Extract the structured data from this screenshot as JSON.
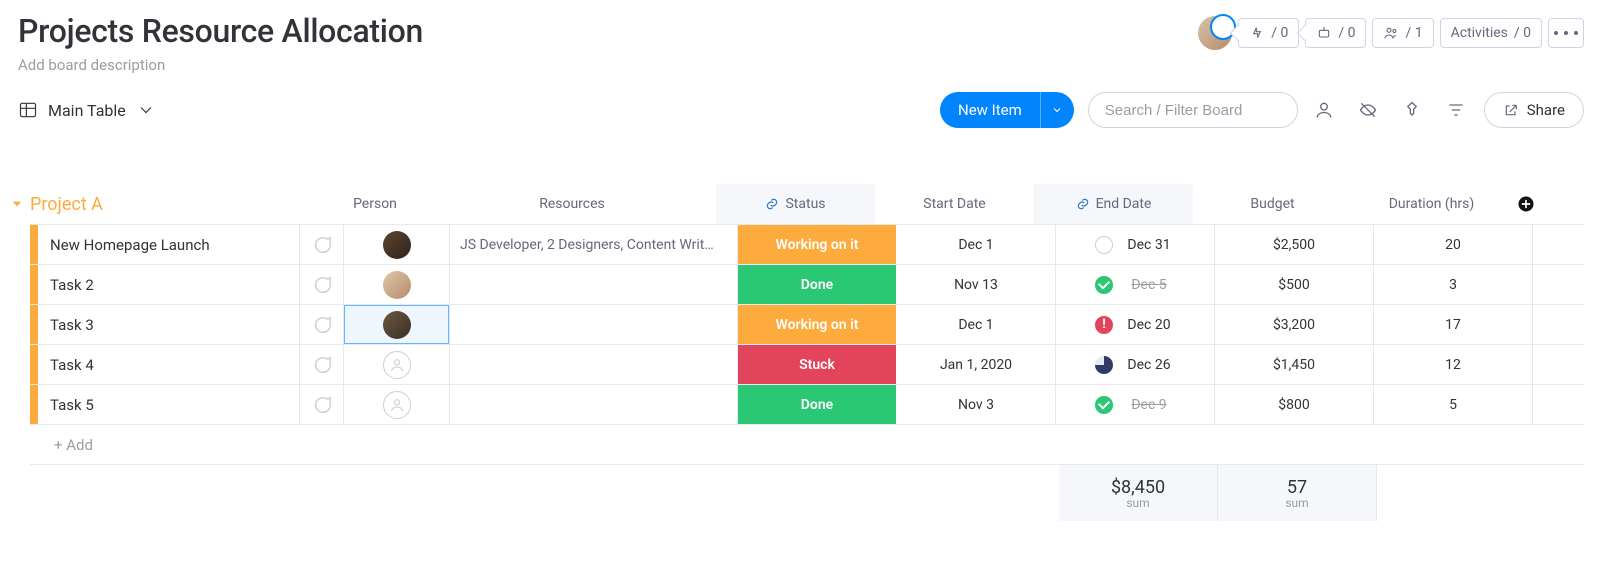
{
  "header": {
    "title": "Projects Resource Allocation",
    "description": "Add board description"
  },
  "pills": {
    "automations": "0",
    "integrations": "0",
    "members": "1",
    "activities_label": "Activities",
    "activities_count": "0"
  },
  "view": {
    "name": "Main Table"
  },
  "toolbar": {
    "new_item": "New Item",
    "search_placeholder": "Search / Filter Board",
    "share": "Share"
  },
  "group": {
    "name": "Project A",
    "columns": {
      "person": "Person",
      "resources": "Resources",
      "status": "Status",
      "start": "Start Date",
      "end": "End Date",
      "budget": "Budget",
      "duration": "Duration (hrs)"
    },
    "rows": [
      {
        "name": "New Homepage Launch",
        "avatar": "pa-1",
        "resources": "JS Developer, 2 Designers, Content Writ…",
        "status": "Working on it",
        "status_cls": "st-working",
        "start": "Dec 1",
        "end": "Dec 31",
        "end_ind": "open",
        "end_strike": false,
        "budget": "$2,500",
        "duration": "20"
      },
      {
        "name": "Task 2",
        "avatar": "pa-2",
        "resources": "",
        "status": "Done",
        "status_cls": "st-done",
        "start": "Nov 13",
        "end": "Dec 5",
        "end_ind": "done",
        "end_strike": true,
        "budget": "$500",
        "duration": "3"
      },
      {
        "name": "Task 3",
        "avatar": "pa-3",
        "resources": "",
        "selected": true,
        "status": "Working on it",
        "status_cls": "st-working",
        "start": "Dec 1",
        "end": "Dec 20",
        "end_ind": "late",
        "end_strike": false,
        "budget": "$3,200",
        "duration": "17"
      },
      {
        "name": "Task 4",
        "avatar": "",
        "resources": "",
        "status": "Stuck",
        "status_cls": "st-stuck",
        "start": "Jan 1, 2020",
        "end": "Dec 26",
        "end_ind": "prog",
        "end_strike": false,
        "budget": "$1,450",
        "duration": "12"
      },
      {
        "name": "Task 5",
        "avatar": "",
        "resources": "",
        "status": "Done",
        "status_cls": "st-done",
        "start": "Nov 3",
        "end": "Dec 9",
        "end_ind": "done",
        "end_strike": true,
        "budget": "$800",
        "duration": "5"
      }
    ],
    "add_row": "+ Add",
    "sums": {
      "budget": "$8,450",
      "duration": "57",
      "label": "sum"
    }
  }
}
